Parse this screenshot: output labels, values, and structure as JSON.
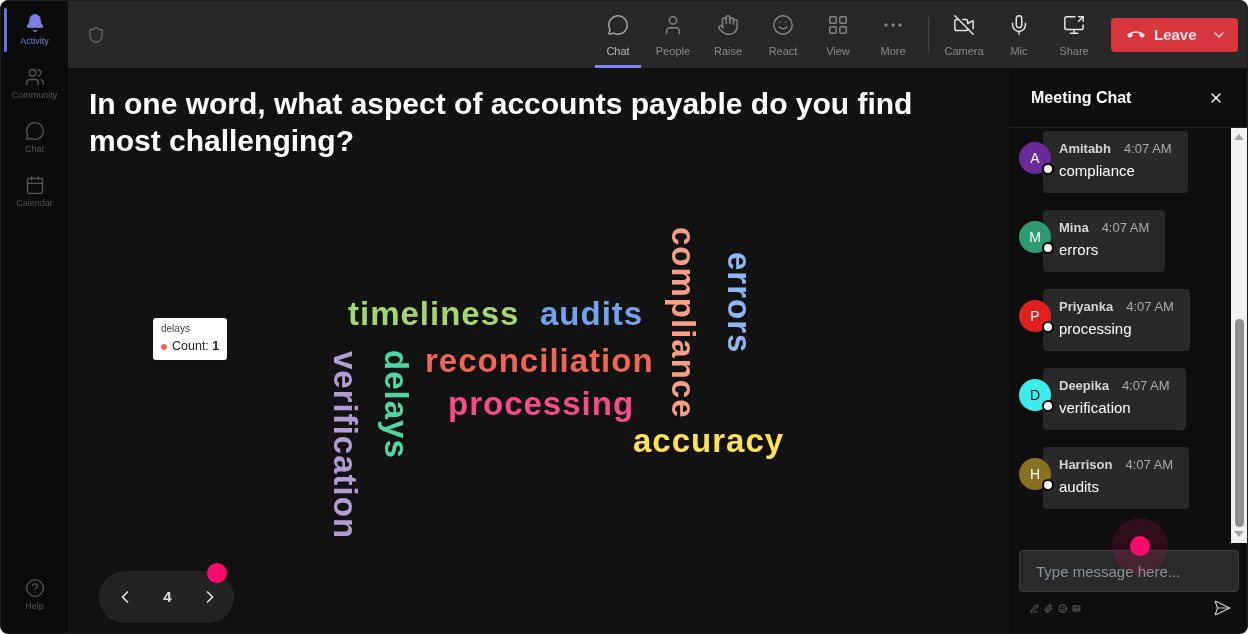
{
  "sidebar": {
    "items": [
      {
        "label": "Activity",
        "selected": true
      },
      {
        "label": "Community",
        "selected": false
      },
      {
        "label": "Chat",
        "selected": false
      },
      {
        "label": "Calendar",
        "selected": false
      }
    ],
    "help": {
      "label": "Help"
    }
  },
  "toolbar": {
    "items": [
      {
        "label": "Chat",
        "selected": true
      },
      {
        "label": "People",
        "selected": false
      },
      {
        "label": "Raise",
        "selected": false
      },
      {
        "label": "React",
        "selected": false
      },
      {
        "label": "View",
        "selected": false
      },
      {
        "label": "More",
        "selected": false
      }
    ],
    "camera": {
      "label": "Camera",
      "on": false
    },
    "mic": {
      "label": "Mic",
      "on": true
    },
    "share": {
      "label": "Share"
    },
    "leave_button": {
      "label": "Leave"
    }
  },
  "question": "In one word, what aspect of accounts payable do you find most challenging?",
  "word_cloud": {
    "words": [
      {
        "text": "compliance",
        "color": "#f79f86",
        "kind": "vertical"
      },
      {
        "text": "errors",
        "color": "#8fb5f2",
        "kind": "vertical"
      },
      {
        "text": "timeliness",
        "color": "#a6d572",
        "kind": "horizontal"
      },
      {
        "text": "audits",
        "color": "#72a2f0",
        "kind": "horizontal"
      },
      {
        "text": "reconciliation",
        "color": "#ef6659",
        "kind": "horizontal"
      },
      {
        "text": "verification",
        "color": "#b39bd4",
        "kind": "vertical"
      },
      {
        "text": "delays",
        "color": "#52d6a0",
        "kind": "vertical"
      },
      {
        "text": "processing",
        "color": "#f44d8a",
        "kind": "horizontal"
      },
      {
        "text": "accuracy",
        "color": "#fbe15c",
        "kind": "horizontal"
      }
    ],
    "tooltip": {
      "title": "delays",
      "text": "Count: **1**",
      "color": "#f0675b"
    }
  },
  "pager": {
    "page": "4"
  },
  "chat": {
    "title": "Meeting Chat",
    "messages": [
      {
        "author": "Amitabh",
        "time": "4:07 AM",
        "text": "compliance",
        "initial": "A",
        "color": "#6b2a9a"
      },
      {
        "author": "Mina",
        "time": "4:07 AM",
        "text": "errors",
        "initial": "M",
        "color": "#2e9a70"
      },
      {
        "author": "Priyanka",
        "time": "4:07 AM",
        "text": "processing",
        "initial": "P",
        "color": "#e0201f"
      },
      {
        "author": "Deepika",
        "time": "4:07 AM",
        "text": "verification",
        "initial": "D",
        "color": "#3eeaea"
      },
      {
        "author": "Harrison",
        "time": "4:07 AM",
        "text": "audits",
        "initial": "H",
        "color": "#8a7022"
      }
    ],
    "composer": {
      "placeholder": "Type message here..."
    }
  }
}
